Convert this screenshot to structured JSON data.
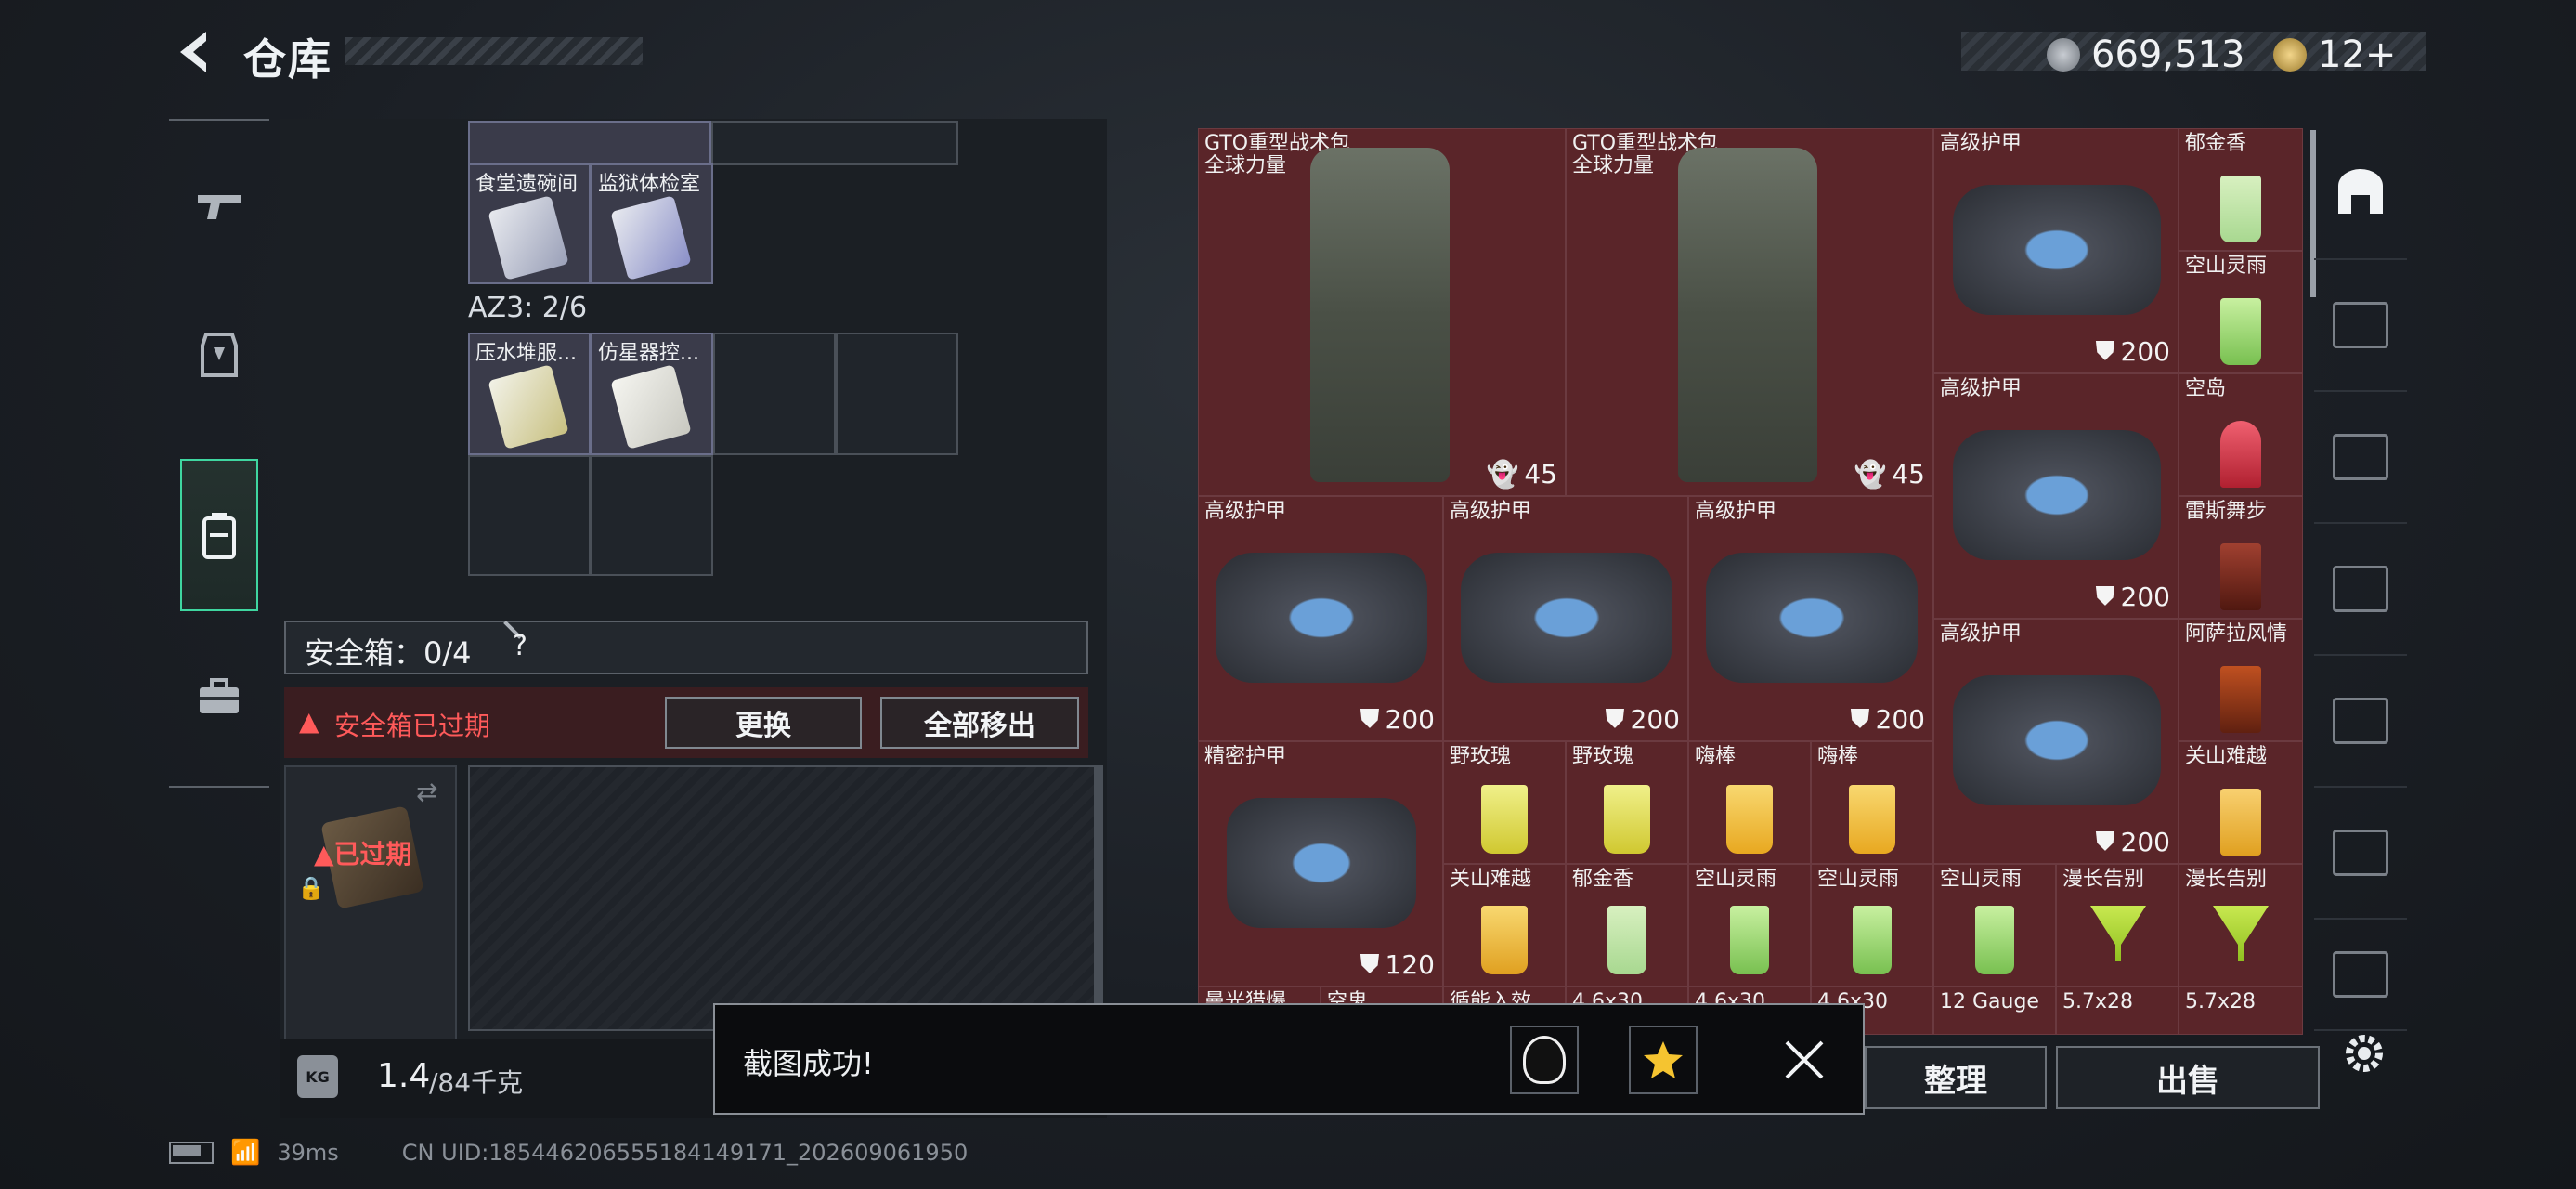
{
  "header": {
    "title": "仓库",
    "currency": "669,513",
    "tokens": "12+"
  },
  "left_nav": [
    "gun-icon",
    "armor-icon",
    "backpack-icon",
    "briefcase-icon"
  ],
  "container_top": {
    "cells": [
      {
        "label": "食堂遗碗间"
      },
      {
        "label": "监狱体检室"
      }
    ]
  },
  "az3": {
    "label": "AZ3: 2/6",
    "cells": [
      {
        "label": "压水堆服..."
      },
      {
        "label": "仿星器控..."
      }
    ]
  },
  "safe_box": {
    "label": "安全箱：0/4",
    "help": "?",
    "expired_msg": "安全箱已过期",
    "replace_btn": "更换",
    "remove_all_btn": "全部移出",
    "expired_tag": "已过期"
  },
  "weight": {
    "value": "1.4",
    "unit": "/84千克"
  },
  "inventory": {
    "backpacks": [
      {
        "name": "GTO重型战术包",
        "sub": "全球力量",
        "count": "45"
      },
      {
        "name": "GTO重型战术包",
        "sub": "全球力量",
        "count": "45"
      }
    ],
    "armor_right": [
      {
        "name": "高级护甲",
        "value": "200"
      },
      {
        "name": "高级护甲",
        "value": "200"
      },
      {
        "name": "高级护甲",
        "value": "200"
      },
      {
        "name": "高级护甲",
        "value": "200"
      }
    ],
    "drinks_col": [
      "郁金香",
      "空山灵雨",
      "空岛",
      "雷斯舞步",
      "阿萨拉风情",
      "关山难越"
    ],
    "armor_row": [
      {
        "name": "高级护甲",
        "value": "200"
      },
      {
        "name": "高级护甲",
        "value": "200"
      },
      {
        "name": "高级护甲",
        "value": "200"
      }
    ],
    "precision_armor": {
      "name": "精密护甲",
      "value": "120"
    },
    "drinks_row1": [
      "野玫瑰",
      "野玫瑰",
      "嗨棒",
      "嗨棒"
    ],
    "drinks_row2": [
      "关山难越",
      "郁金香",
      "空山灵雨",
      "空山灵雨",
      "空山灵雨",
      "漫长告别",
      "漫长告别"
    ],
    "ammo_row": [
      "曼光猎爆",
      "空鬼",
      "循能入效",
      "4.6x30",
      "4.6x30",
      "4.6x30",
      "12 Gauge",
      "5.7x28",
      "5.7x28"
    ]
  },
  "bottom_buttons": {
    "sort": "整理",
    "sell": "出售"
  },
  "toast": {
    "message": "截图成功!"
  },
  "status": {
    "latency": "39ms",
    "uid": "CN UID:185446206555184149171_202609061950"
  },
  "right_nav": [
    "home-icon",
    "tier4-icon-a",
    "tier3-icon",
    "tier3-icon-b",
    "tier5-icon",
    "tier4-icon-b",
    "tier4-icon-c"
  ]
}
